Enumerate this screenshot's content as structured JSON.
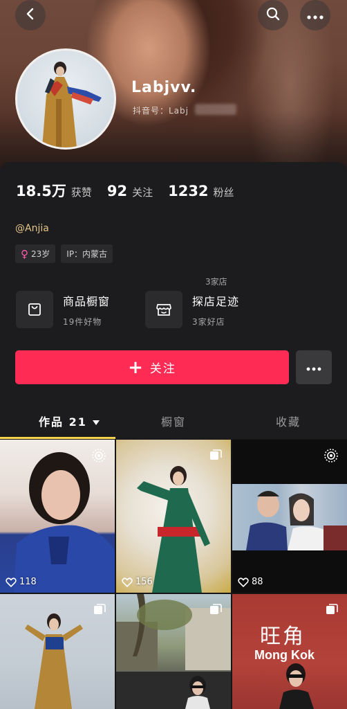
{
  "profile": {
    "nickname": "Labjvv.",
    "douyin_id_label": "抖音号：Labj",
    "stats": [
      {
        "value": "18.5万",
        "label": "获赞"
      },
      {
        "value": "92",
        "label": "关注"
      },
      {
        "value": "1232",
        "label": "粉丝"
      }
    ],
    "mention": "@Anjia",
    "tags": {
      "age": "23岁",
      "ip": "IP：内蒙古"
    }
  },
  "shop": {
    "window_title": "商品橱窗",
    "window_sub": "19件好物",
    "store_top": "3家店",
    "store_title": "探店足迹",
    "store_sub": "3家好店"
  },
  "actions": {
    "follow_label": "关注"
  },
  "tabs": {
    "works": "作品 21",
    "window": "橱窗",
    "favorites": "收藏"
  },
  "videos": [
    {
      "likes": "118"
    },
    {
      "likes": "156"
    },
    {
      "likes": "88"
    },
    {
      "likes": ""
    },
    {
      "likes": ""
    },
    {
      "likes": "",
      "sign_cn": "旺角",
      "sign_en": "Mong Kok"
    }
  ],
  "colors": {
    "accent": "#fe2c55",
    "tab_underline": "#f7d54a",
    "panel": "#1c1c1e"
  }
}
